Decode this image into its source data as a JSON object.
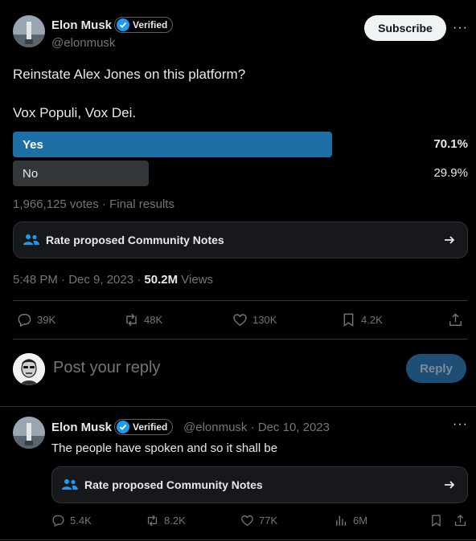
{
  "tweet": {
    "author_name": "Elon Musk",
    "verified_label": "Verified",
    "handle": "@elonmusk",
    "subscribe_label": "Subscribe",
    "more_label": "···",
    "text_line1": "Reinstate Alex Jones on this platform?",
    "text_line2": "Vox Populi, Vox Dei.",
    "poll": {
      "options": [
        {
          "label": "Yes",
          "percent": "70.1%",
          "fraction": 0.701,
          "color": "#1d6fa5"
        },
        {
          "label": "No",
          "percent": "29.9%",
          "fraction": 0.299,
          "color": "#333639"
        }
      ],
      "summary": "1,966,125 votes · Final results"
    },
    "community_notes_label": "Rate proposed Community Notes",
    "time": "5:48 PM · Dec 9, 2023 · ",
    "views_count": "50.2M",
    "views_label": " Views",
    "actions": {
      "replies": "39K",
      "reposts": "48K",
      "likes": "130K",
      "bookmarks": "4.2K"
    }
  },
  "reply_box": {
    "placeholder": "Post your reply",
    "button_label": "Reply"
  },
  "reply": {
    "author_name": "Elon Musk",
    "verified_label": "Verified",
    "meta": "@elonmusk · Dec 10, 2023",
    "more_label": "···",
    "text": "The people have spoken and so it shall be",
    "community_notes_label": "Rate proposed Community Notes",
    "actions": {
      "replies": "5.4K",
      "reposts": "8.2K",
      "likes": "77K",
      "views": "6M"
    }
  },
  "colors": {
    "accent": "#1d9bf0",
    "background": "#000000",
    "text": "#e7e9ea",
    "muted": "#71767b"
  }
}
